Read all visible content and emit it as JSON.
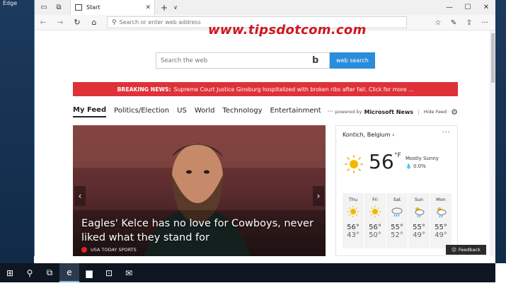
{
  "desktop": {
    "label": "Edge"
  },
  "browser": {
    "tab": {
      "title": "Start"
    },
    "address": {
      "placeholder": "Search or enter web address"
    },
    "watermark": "www.tipsdotcom.com"
  },
  "page": {
    "search": {
      "placeholder": "Search the web",
      "button": "web search"
    },
    "breaking": {
      "label": "BREAKING NEWS:",
      "text": "Supreme Court Justice Ginsburg hospitalized with broken ribs after fall. Click for more ..."
    },
    "feed": {
      "tabs": [
        "My Feed",
        "Politics/Election",
        "US",
        "World",
        "Technology",
        "Entertainment"
      ],
      "more": "···",
      "powered_by": "powered by",
      "provider": "Microsoft News",
      "hide": "Hide Feed"
    },
    "hero": {
      "headline": "Eagles' Kelce has no love for Cowboys, never liked what they stand for",
      "source": "USA TODAY SPORTS"
    },
    "weather": {
      "location": "Kontich, Belgium",
      "temp": "56",
      "unit": "°F",
      "condition": "Mostly Sunny",
      "precip": "0.0%",
      "days": [
        {
          "name": "Thu",
          "icon": "sun-icon",
          "hi": "56°",
          "lo": "43°"
        },
        {
          "name": "Fri",
          "icon": "sun-icon",
          "hi": "56°",
          "lo": "50°"
        },
        {
          "name": "Sat",
          "icon": "rain-icon",
          "hi": "55°",
          "lo": "52°"
        },
        {
          "name": "Sun",
          "icon": "partly-sunny-rain-icon",
          "hi": "55°",
          "lo": "49°"
        },
        {
          "name": "Mon",
          "icon": "partly-sunny-rain-icon",
          "hi": "55°",
          "lo": "49°"
        }
      ]
    },
    "feedback": "Feedback"
  },
  "colors": {
    "accent": "#2a8ddb",
    "breaking": "#df3138",
    "watermark": "#d0171f"
  }
}
